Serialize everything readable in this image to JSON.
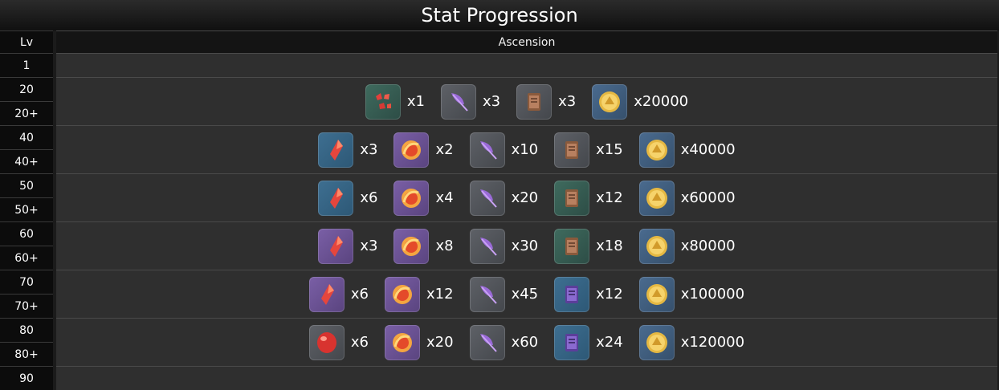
{
  "title": "Stat Progression",
  "headers": {
    "lv": "Lv",
    "ascension": "Ascension"
  },
  "rows": [
    {
      "levels": [
        "1"
      ],
      "materials": []
    },
    {
      "levels": [
        "20",
        "20+"
      ],
      "materials": [
        {
          "icon": "red-gem-shards-icon",
          "qty": "x1",
          "bg": "green"
        },
        {
          "icon": "purple-feather-icon",
          "qty": "x3",
          "bg": "gray"
        },
        {
          "icon": "brown-scroll-icon",
          "qty": "x3",
          "bg": "gray"
        },
        {
          "icon": "gold-coin-icon",
          "qty": "x20000",
          "bg": "gold"
        }
      ]
    },
    {
      "levels": [
        "40",
        "40+"
      ],
      "materials": [
        {
          "icon": "red-crystal-icon",
          "qty": "x3",
          "bg": "blue"
        },
        {
          "icon": "flame-orb-icon",
          "qty": "x2",
          "bg": "purple"
        },
        {
          "icon": "purple-feather-icon",
          "qty": "x10",
          "bg": "gray"
        },
        {
          "icon": "brown-scroll-icon",
          "qty": "x15",
          "bg": "gray"
        },
        {
          "icon": "gold-coin-icon",
          "qty": "x40000",
          "bg": "gold"
        }
      ]
    },
    {
      "levels": [
        "50",
        "50+"
      ],
      "materials": [
        {
          "icon": "red-crystal-icon",
          "qty": "x6",
          "bg": "blue"
        },
        {
          "icon": "flame-orb-icon",
          "qty": "x4",
          "bg": "purple"
        },
        {
          "icon": "purple-feather-icon",
          "qty": "x20",
          "bg": "gray"
        },
        {
          "icon": "brown-scroll-icon",
          "qty": "x12",
          "bg": "green"
        },
        {
          "icon": "gold-coin-icon",
          "qty": "x60000",
          "bg": "gold"
        }
      ]
    },
    {
      "levels": [
        "60",
        "60+"
      ],
      "materials": [
        {
          "icon": "red-crystal-icon",
          "qty": "x3",
          "bg": "purple"
        },
        {
          "icon": "flame-orb-icon",
          "qty": "x8",
          "bg": "purple"
        },
        {
          "icon": "purple-feather-icon",
          "qty": "x30",
          "bg": "gray"
        },
        {
          "icon": "brown-scroll-icon",
          "qty": "x18",
          "bg": "green"
        },
        {
          "icon": "gold-coin-icon",
          "qty": "x80000",
          "bg": "gold"
        }
      ]
    },
    {
      "levels": [
        "70",
        "70+"
      ],
      "materials": [
        {
          "icon": "red-crystal-icon",
          "qty": "x6",
          "bg": "purple"
        },
        {
          "icon": "flame-orb-icon",
          "qty": "x12",
          "bg": "purple"
        },
        {
          "icon": "purple-feather-icon",
          "qty": "x45",
          "bg": "gray"
        },
        {
          "icon": "purple-scroll-icon",
          "qty": "x12",
          "bg": "blue"
        },
        {
          "icon": "gold-coin-icon",
          "qty": "x100000",
          "bg": "gold"
        }
      ]
    },
    {
      "levels": [
        "80",
        "80+"
      ],
      "materials": [
        {
          "icon": "red-gem-round-icon",
          "qty": "x6",
          "bg": "gray"
        },
        {
          "icon": "flame-orb-icon",
          "qty": "x20",
          "bg": "purple"
        },
        {
          "icon": "purple-feather-icon",
          "qty": "x60",
          "bg": "gray"
        },
        {
          "icon": "purple-scroll-icon",
          "qty": "x24",
          "bg": "blue"
        },
        {
          "icon": "gold-coin-icon",
          "qty": "x120000",
          "bg": "gold"
        }
      ]
    },
    {
      "levels": [
        "90"
      ],
      "materials": []
    }
  ]
}
